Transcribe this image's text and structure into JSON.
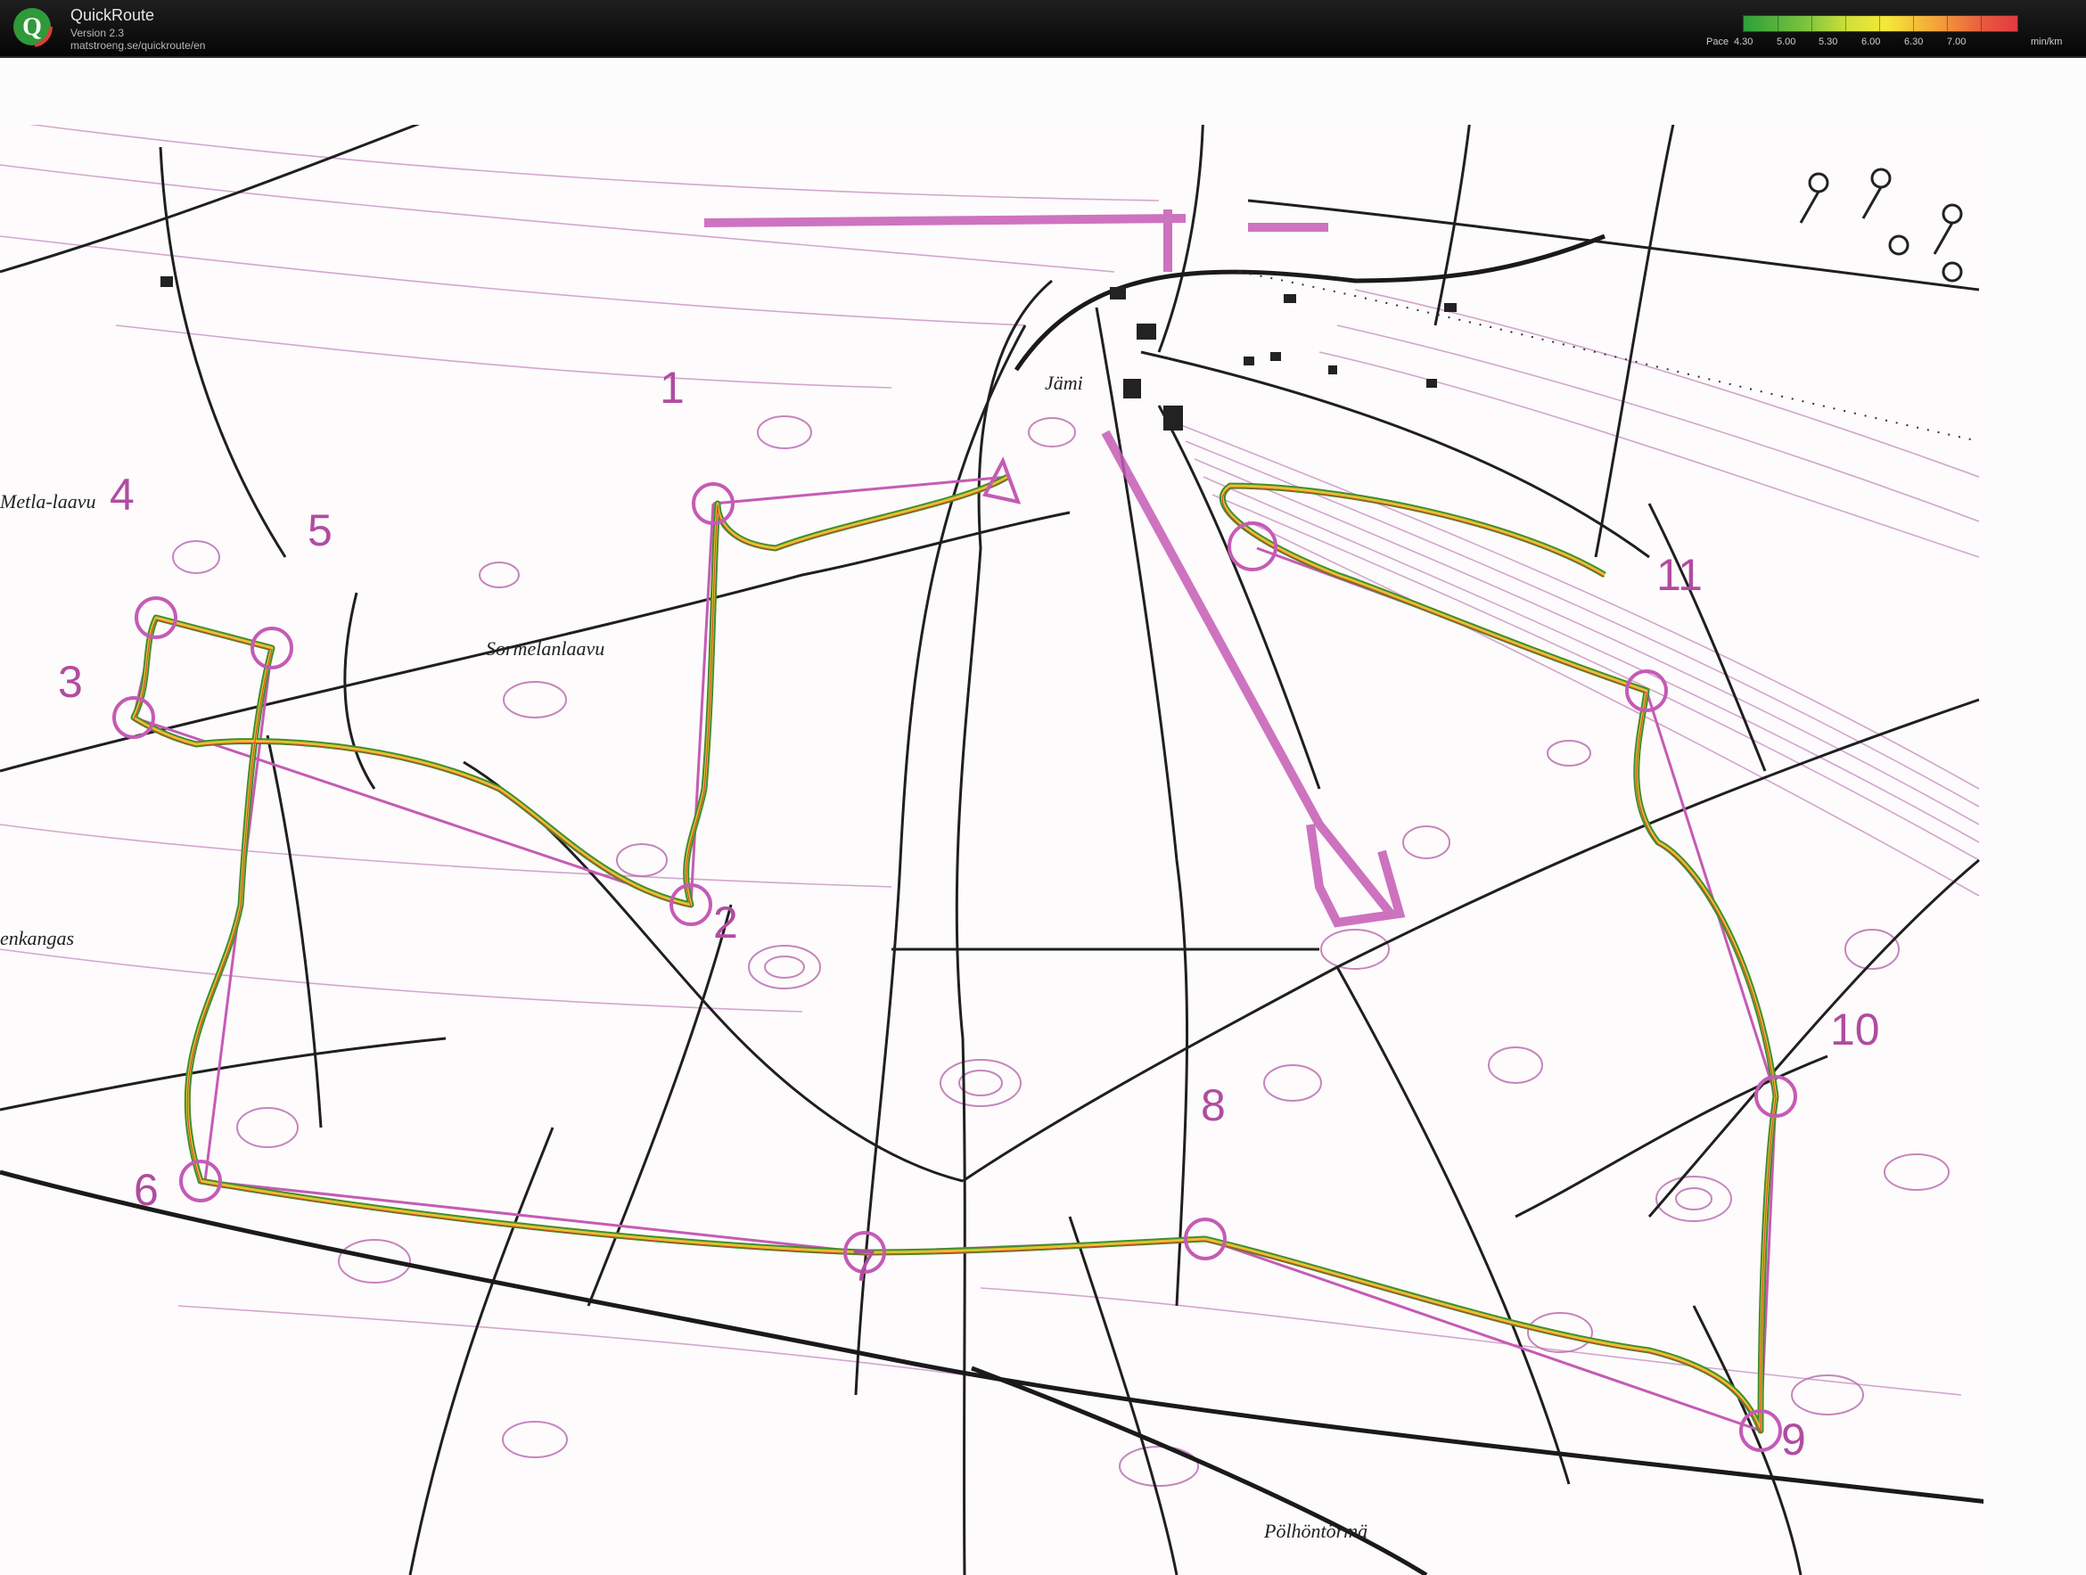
{
  "header": {
    "app_name": "QuickRoute",
    "version": "Version 2.3",
    "url": "matstroeng.se/quickroute/en",
    "logo_letter": "Q"
  },
  "pace_scale": {
    "label": "Pace",
    "ticks": [
      "4.30",
      "5.00",
      "5.30",
      "6.00",
      "6.30",
      "7.00"
    ],
    "unit": "min/km"
  },
  "map": {
    "place_names": {
      "jami": "Jämi",
      "metla": "Metla-laavu",
      "sormelan": "Sormelanlaavu",
      "enkangas": "enkangas",
      "polhontorma": "Pölhöntörmä"
    },
    "controls": [
      "1",
      "2",
      "3",
      "4",
      "5",
      "6",
      "7",
      "8",
      "9",
      "10",
      "11"
    ],
    "colors": {
      "course": "#c55bb5",
      "track_green": "#3f8f2f",
      "track_yellow": "#e7c02e",
      "track_red": "#d24030",
      "contour": "#b878b0",
      "path": "#1e1e1e"
    }
  }
}
